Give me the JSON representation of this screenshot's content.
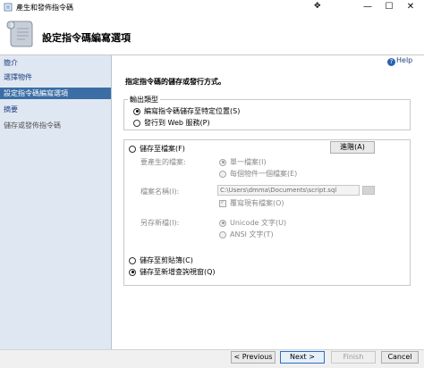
{
  "window": {
    "title": "產生和發佈指令碼",
    "controls": {
      "minimize": "—",
      "maximize": "☐",
      "close": "✕"
    }
  },
  "header": {
    "title": "設定指令碼編寫選項"
  },
  "sidebar": {
    "items": [
      {
        "label": "簡介"
      },
      {
        "label": "選擇物件"
      },
      {
        "label": "設定指令碼編寫選項"
      },
      {
        "label": "摘要"
      },
      {
        "label": "儲存或發佈指令碼"
      }
    ]
  },
  "help": {
    "icon": "?",
    "label": "Help"
  },
  "instruction": "指定指令碼的儲存或發行方式。",
  "output_type": {
    "group_label": "輸出類型",
    "option_save": "編寫指令碼儲存至特定位置(S)",
    "option_publish": "發行到 Web 服務(P)"
  },
  "save_options": {
    "save_to_file": "儲存至檔案(F)",
    "advanced_button": "進階(A)",
    "files_to_generate_label": "要產生的檔案:",
    "single_file": "單一檔案(I)",
    "file_per_object": "每個物件一個檔案(E)",
    "file_name_label": "檔案名稱(I):",
    "file_name_value": "C:\\Users\\dmma\\Documents\\script.sql",
    "overwrite_existing": "覆寫現有檔案(O)",
    "save_as_label": "另存新檔(I):",
    "unicode_text": "Unicode 文字(U)",
    "ansi_text": "ANSI 文字(T)",
    "save_to_clipboard": "儲存至剪貼簿(C)",
    "save_to_new_query_window": "儲存至新增查詢視窗(Q)"
  },
  "footer": {
    "previous": "< Previous",
    "next": "Next >",
    "finish": "Finish",
    "cancel": "Cancel"
  }
}
